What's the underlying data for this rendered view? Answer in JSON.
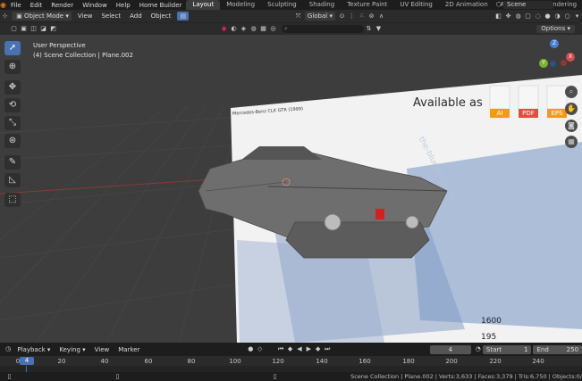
{
  "menubar": {
    "items": [
      "File",
      "Edit",
      "Render",
      "Window",
      "Help",
      "Home Builder"
    ],
    "workspaces": [
      "Layout",
      "Modeling",
      "Sculpting",
      "Shading",
      "Texture Paint",
      "UV Editing",
      "2D Animation",
      "Animation",
      "Rendering"
    ],
    "scene": "Scene"
  },
  "header": {
    "mode": "Object Mode",
    "menus": [
      "View",
      "Select",
      "Add",
      "Object"
    ],
    "orientation": "Global"
  },
  "row2": {
    "search_placeholder": "",
    "options": "Options"
  },
  "viewport": {
    "perspective": "User Perspective",
    "collection": "(4) Scene Collection | Plane.002",
    "blueprint_title": "Mercedes-Benz CLK GTR (1999)",
    "available_as": "Available as",
    "formats": [
      "AI",
      "PDF",
      "EPS"
    ],
    "dim1": "1600",
    "dim2": "195",
    "watermark": "the-blueprints.com"
  },
  "gizmo": {
    "x": "X",
    "y": "Y",
    "z": "Z"
  },
  "timeline": {
    "menus": [
      "Playback",
      "Keying",
      "View",
      "Marker"
    ],
    "current_frame": "4",
    "start_label": "Start",
    "start": "1",
    "end_label": "End",
    "end": "250",
    "cursor_frame": "4",
    "ticks": [
      "0",
      "20",
      "40",
      "60",
      "80",
      "100",
      "120",
      "140",
      "160",
      "180",
      "200",
      "220",
      "240"
    ]
  },
  "status": {
    "stats": "Scene Collection | Plane.002 | Verts:3,633 | Faces:3,379 | Tris:6,750 | Objects:0/"
  },
  "colors": {
    "accent": "#4772b3",
    "blender_orange": "#e87d0d",
    "x_axis": "#d44d4d",
    "y_axis": "#7ab334",
    "z_axis": "#4a80d4"
  }
}
